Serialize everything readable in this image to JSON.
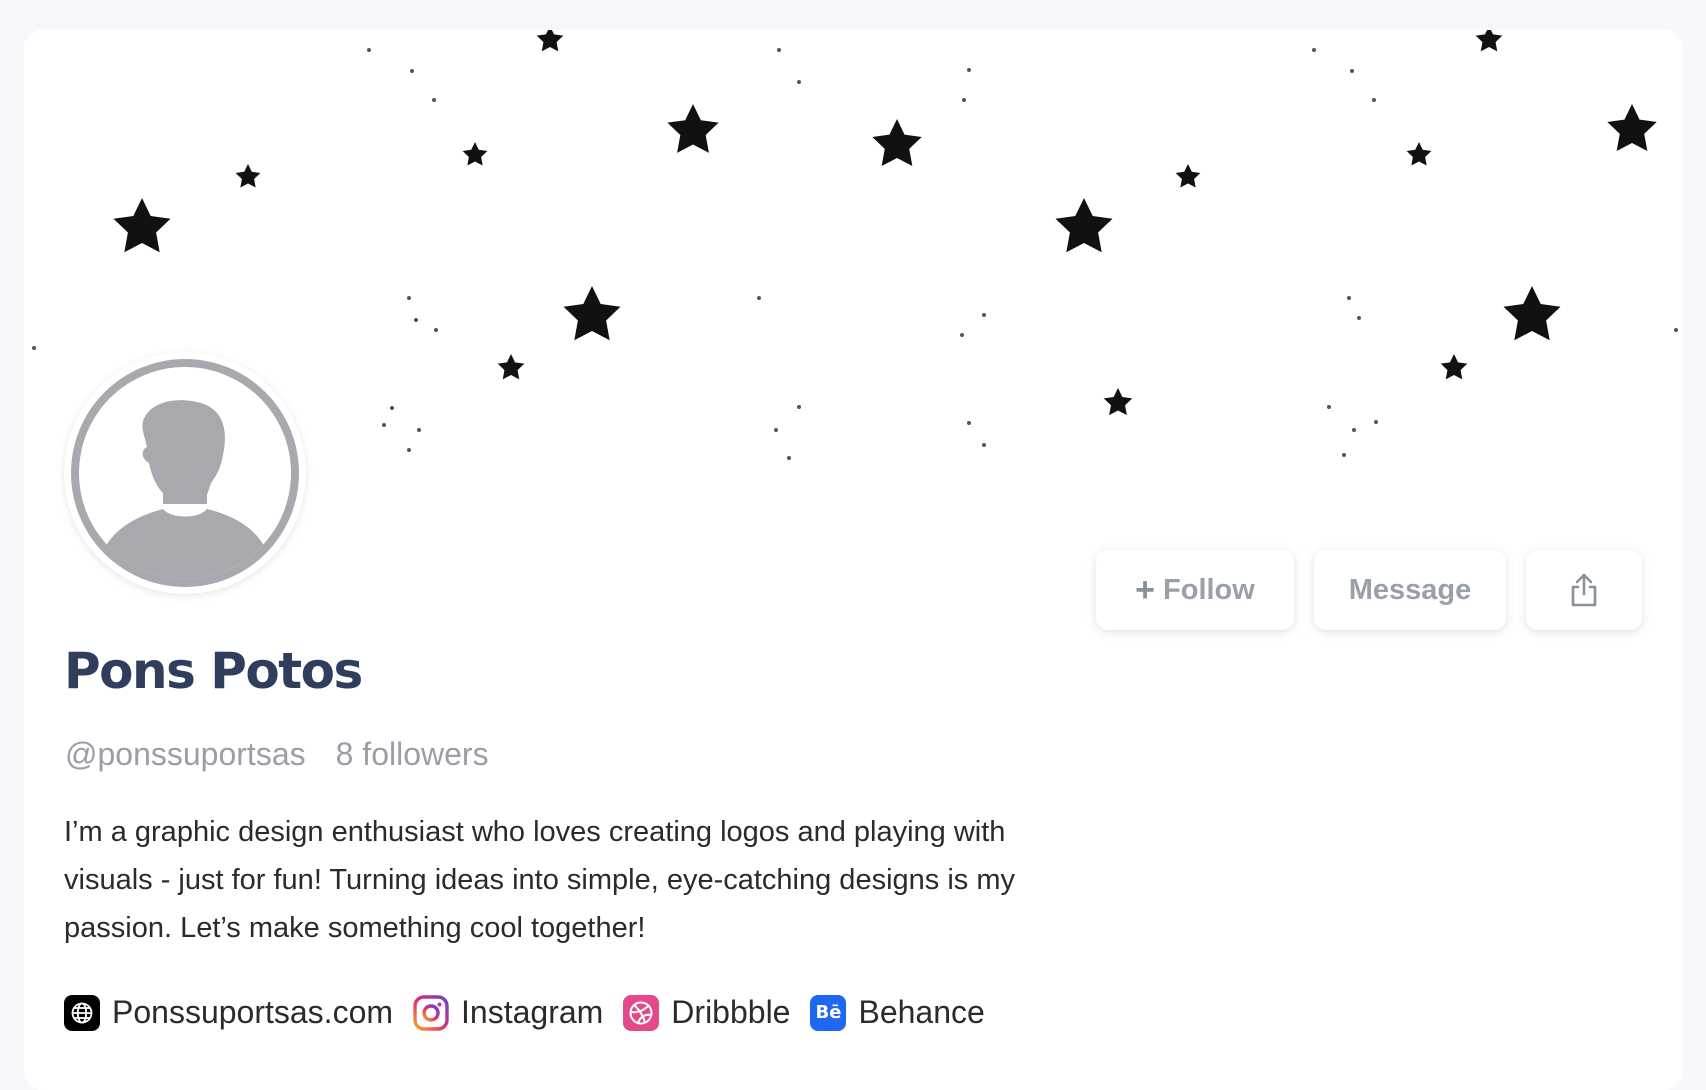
{
  "profile": {
    "name": "Pons Potos",
    "handle": "@ponssuportsas",
    "followers": "8 followers",
    "bio": "I’m a graphic design enthusiast who loves creating logos and playing with visuals - just for fun! Turning ideas into simple, eye-catching designs is my passion. Let’s make something cool together!"
  },
  "actions": {
    "follow_icon": "+",
    "follow_label": "Follow",
    "message_label": "Message",
    "share_icon": "share-icon"
  },
  "links": [
    {
      "label": "Ponssuportsas.com",
      "icon": "globe-icon"
    },
    {
      "label": "Instagram",
      "icon": "instagram-icon"
    },
    {
      "label": "Dribbble",
      "icon": "dribbble-icon"
    },
    {
      "label": "Behance",
      "icon": "behance-icon",
      "glyph": "Bē"
    }
  ],
  "colors": {
    "name": "#2f3e5d",
    "muted": "#9a9ea6",
    "behance": "#1f66f0",
    "dribbble": "#e4498b"
  }
}
